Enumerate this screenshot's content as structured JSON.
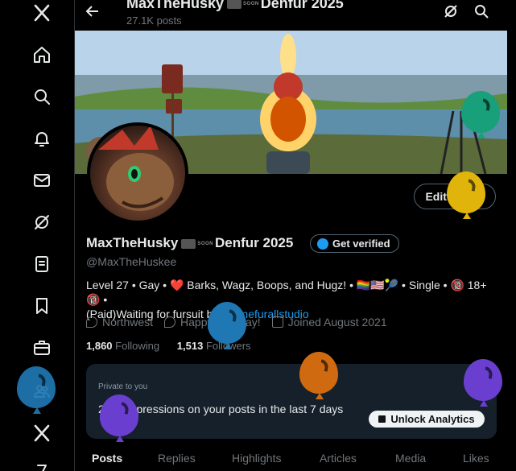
{
  "sidebar": {
    "items": [
      {
        "icon": "x-logo-icon"
      },
      {
        "icon": "home-icon"
      },
      {
        "icon": "search-icon"
      },
      {
        "icon": "bell-icon"
      },
      {
        "icon": "mail-icon"
      },
      {
        "icon": "grok-icon"
      },
      {
        "icon": "list-icon"
      },
      {
        "icon": "bookmark-icon"
      },
      {
        "icon": "briefcase-icon"
      },
      {
        "icon": "communities-icon"
      },
      {
        "icon": "premium-x-icon"
      }
    ]
  },
  "header": {
    "title_prefix": "MaxTheHusky",
    "soon": "SOON",
    "title_suffix": "Denfur 2025",
    "posts": "27.1K posts"
  },
  "profile": {
    "edit_label": "Edit profile",
    "name_prefix": "MaxTheHusky",
    "soon": "SOON",
    "name_suffix": "Denfur 2025",
    "verify_label": "Get verified",
    "handle": "@MaxTheHuskee",
    "bio_line1": "Level 27 • Gay • ❤️ Barks, Wagz, Boops, and Hugz! • 🏳️‍🌈🇺🇸🎾 • Single • 🔞 18+ 🔞 •",
    "bio_line2_prefix": "(Paid)Waiting for fursuit by ",
    "bio_link": "@Onefurallstudio",
    "location": "Northwest",
    "birthday": "Happy Birthday!",
    "joined": "Joined August 2021",
    "following_count": "1,860",
    "following_label": "Following",
    "followers_count": "1,513",
    "followers_label": "Followers"
  },
  "analytics": {
    "private": "Private to you",
    "message": "2.4K impressions on your posts in the last 7 days",
    "unlock_label": "Unlock Analytics",
    "close": "✕"
  },
  "tabs": [
    {
      "label": "Posts",
      "active": true
    },
    {
      "label": "Replies"
    },
    {
      "label": "Highlights"
    },
    {
      "label": "Articles"
    },
    {
      "label": "Media"
    },
    {
      "label": "Likes"
    }
  ],
  "colors": {
    "accent": "#1d9bf0",
    "balloon_green": "#17a07a",
    "balloon_yellow": "#e1b40c",
    "balloon_blue": "#1f78b4",
    "balloon_orange": "#d06a10",
    "balloon_purple": "#6a3fd0"
  }
}
